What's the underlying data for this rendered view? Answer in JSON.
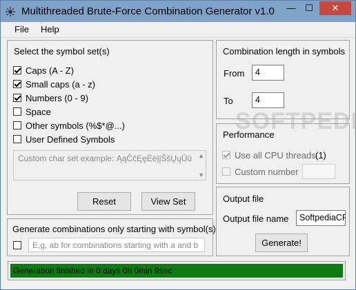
{
  "window": {
    "title": "Multithreaded Brute-Force Combination Generator v1.0",
    "controls": {
      "minimize": "—",
      "maximize": "☐",
      "close": "✕"
    }
  },
  "menu": {
    "file": "File",
    "help": "Help"
  },
  "symbol_set": {
    "title": "Select the symbol set(s)",
    "options": [
      {
        "label": "Caps (A - Z)",
        "checked": true
      },
      {
        "label": "Small caps (a - z)",
        "checked": true
      },
      {
        "label": "Numbers (0 - 9)",
        "checked": true
      },
      {
        "label": "Space",
        "checked": false
      },
      {
        "label": "Other symbols (%$*@...)",
        "checked": false
      },
      {
        "label": "User Defined Symbols",
        "checked": false
      }
    ],
    "custom_placeholder": "Custom char set example: ĄąČčĘęĖėĮįŠšŲųŪū",
    "reset_label": "Reset",
    "view_set_label": "View Set"
  },
  "starting": {
    "title": "Generate combinations only starting with symbol(s)",
    "placeholder": "E,g, ab for combinations starting with a and b"
  },
  "length": {
    "title": "Combination length in symbols",
    "from_label": "From",
    "from_value": "4",
    "to_label": "To",
    "to_value": "4"
  },
  "performance": {
    "title": "Performance",
    "all_cpu_label": "Use all CPU threads",
    "cpu_count": "(1)",
    "custom_label": "Custom number"
  },
  "output": {
    "title": "Output file",
    "name_label": "Output file name",
    "name_value": "SoftpediaCF",
    "generate_label": "Generate!"
  },
  "status": {
    "text": "Generation finished in 0 days 0h 0min 9sec",
    "progress": 1.0
  },
  "watermark": "SOFTPEDIA®",
  "colors": {
    "titlebar": "#7fa2c8",
    "progress": "#0e7a12",
    "close": "#c7483f"
  }
}
